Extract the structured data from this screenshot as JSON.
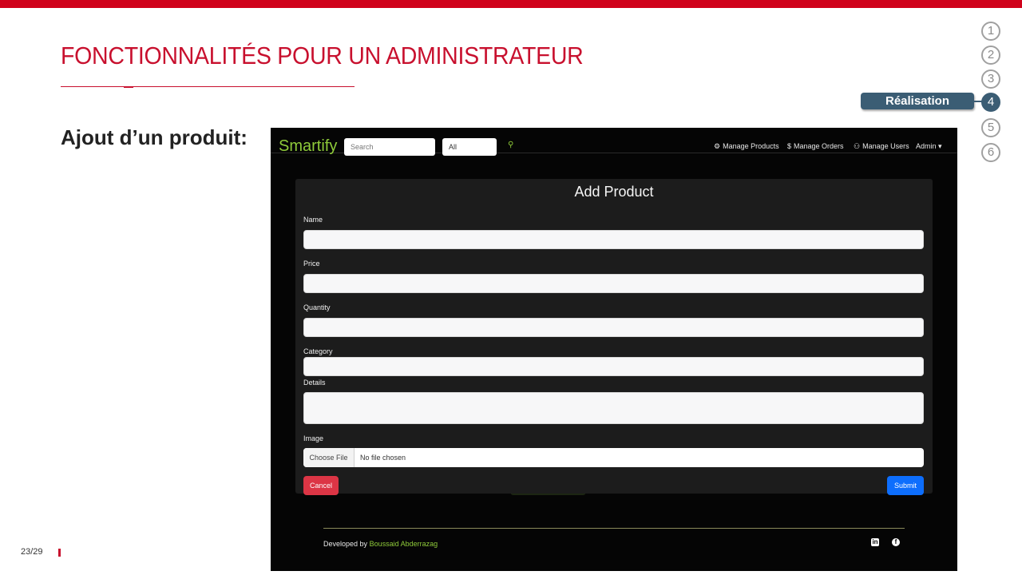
{
  "slide": {
    "title": "FONCTIONNALITÉS POUR UN ADMINISTRATEUR",
    "subtitle": "Ajout d’un produit:",
    "page_number": "23/29"
  },
  "steps": {
    "items": [
      "1",
      "2",
      "3",
      "4",
      "5",
      "6"
    ],
    "active_index": 3,
    "active_label": "Réalisation"
  },
  "app": {
    "brand": "Smartify",
    "search_placeholder": "Search",
    "category_select": "All",
    "search_icon": "search-icon",
    "nav": {
      "manage_products": "Manage Products",
      "manage_orders": "Manage Orders",
      "manage_users": "Manage Users",
      "admin": "Admin"
    },
    "form": {
      "title": "Add Product",
      "labels": {
        "name": "Name",
        "price": "Price",
        "quantity": "Quantity",
        "category": "Category",
        "details": "Details",
        "image": "Image"
      },
      "file_button": "Choose File",
      "file_status": "No file chosen",
      "cancel": "Cancel",
      "submit": "Submit"
    },
    "footer": {
      "developed_by": "Developed by",
      "author": "Boussaid Abderrazag"
    },
    "colors": {
      "brand": "#8fcb3a",
      "cancel": "#dc3545",
      "submit": "#0d6efd",
      "accent_red": "#c8102e",
      "step_blue": "#3b5d74"
    }
  }
}
